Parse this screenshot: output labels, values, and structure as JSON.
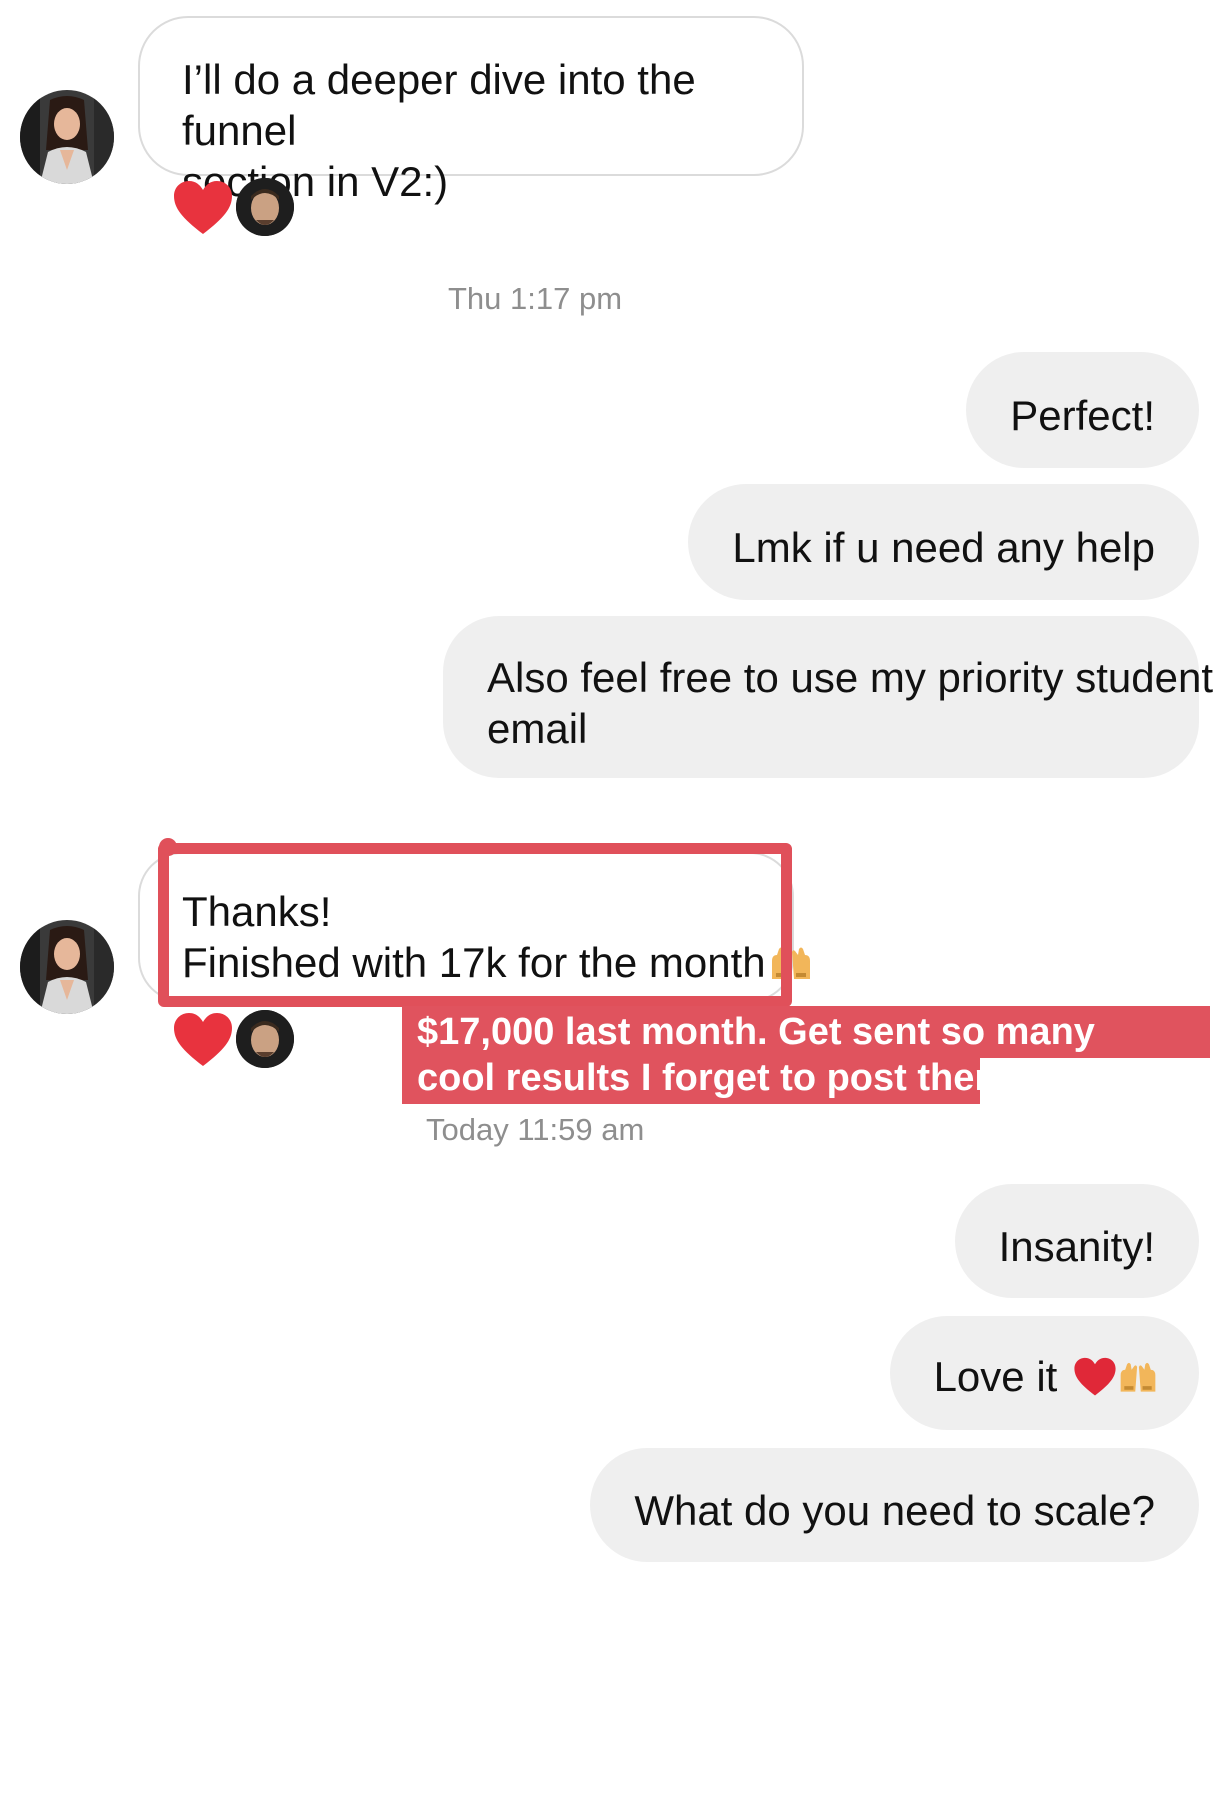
{
  "messages": [
    {
      "sender": "other",
      "text": "I’ll do a deeper dive into the funnel section in V2:)",
      "reactions": [
        "heart-icon",
        "reactor-avatar"
      ]
    },
    {
      "timestamp": "Thu 1:17 pm"
    },
    {
      "sender": "me",
      "text": "Perfect!"
    },
    {
      "sender": "me",
      "text": "Lmk if u need any help"
    },
    {
      "sender": "me",
      "text": "Also feel free to use my priority student email"
    },
    {
      "sender": "other",
      "text_line1": "Thanks!",
      "text_line2": "Finished with 17k for the month",
      "emoji": "raising-hands-icon",
      "reactions": [
        "heart-icon",
        "reactor-avatar"
      ],
      "highlighted": true
    },
    {
      "timestamp": "Today 11:59 am"
    },
    {
      "sender": "me",
      "text": "Insanity!"
    },
    {
      "sender": "me",
      "text": "Love it",
      "emoji": [
        "heart-emoji",
        "raising-hands-icon"
      ]
    },
    {
      "sender": "me",
      "text": "What do you need to scale?"
    }
  ],
  "conversation": {
    "msg1": {
      "line1": "I’ll do a deeper dive into the funnel",
      "line2": "section in V2:)"
    },
    "time1": "Thu 1:17 pm",
    "msg2": "Perfect!",
    "msg3": "Lmk if u need any help",
    "msg4": {
      "line1": "Also feel free to use my priority student",
      "line2": "email"
    },
    "msg5": {
      "line1": "Thanks!",
      "line2": "Finished with 17k for the month"
    },
    "annotation": {
      "line1": "$17,000 last month. Get sent so many",
      "line2": "cool results I forget to post them"
    },
    "time2": "Today 11:59 am",
    "msg6": "Insanity!",
    "msg7": "Love it",
    "msg8": "What do you need to scale?"
  },
  "colors": {
    "incoming_bubble_border": "#dbdbdb",
    "outgoing_bubble_bg": "#efefef",
    "timestamp": "#8e8e8e",
    "highlight": "#e0505a",
    "heart": "#e8333e"
  }
}
